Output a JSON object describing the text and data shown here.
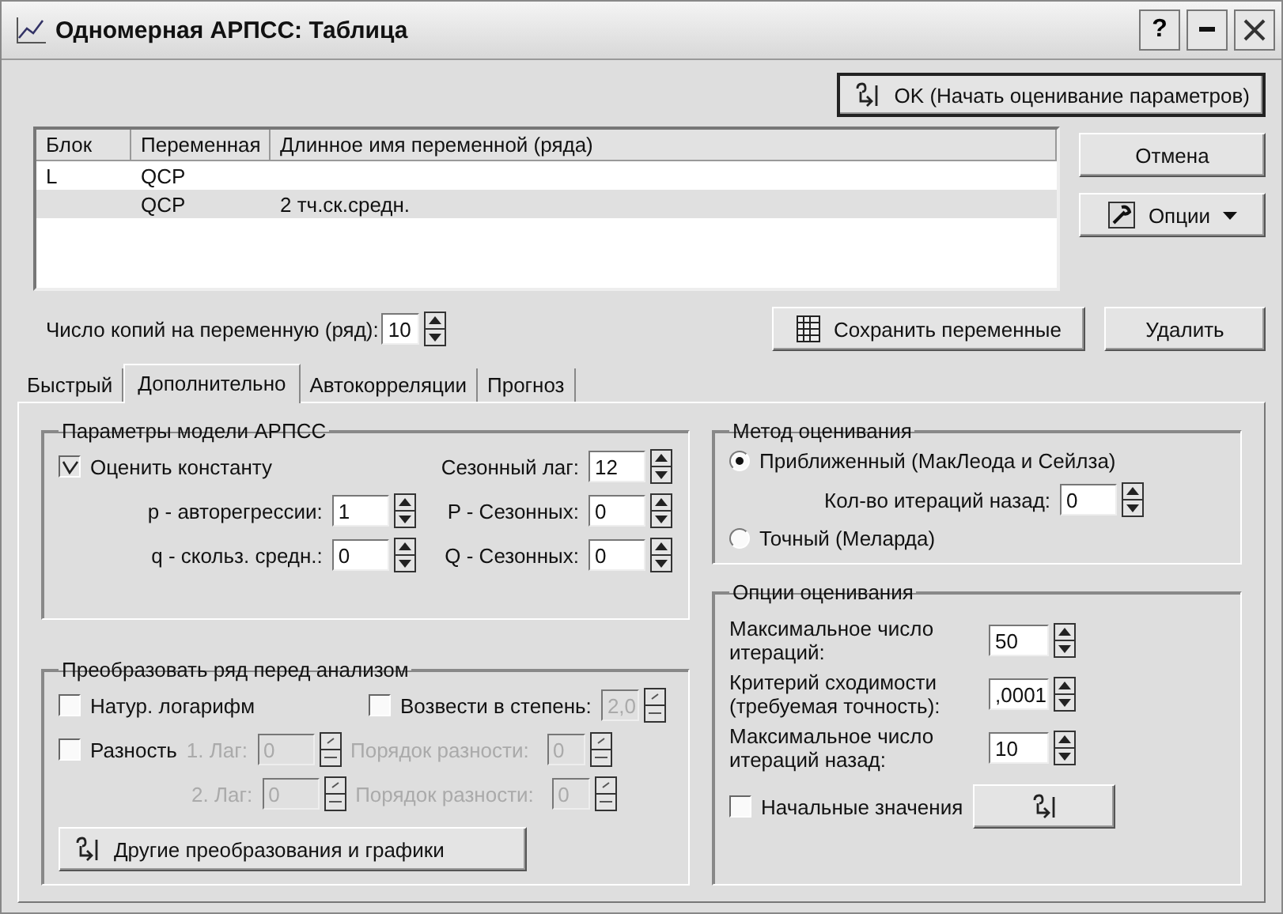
{
  "window": {
    "title": "Одномерная АРПСС: Таблица",
    "help": "?"
  },
  "ok_button": "OK (Начать оценивание параметров)",
  "table": {
    "columns": [
      "Блок",
      "Переменная",
      "Длинное имя переменной (ряда)"
    ],
    "rows": [
      {
        "block": "L",
        "variable": "QCP",
        "selected": false
      },
      {
        "variable": "QCP",
        "long_name": "2 тч.ск.средн.",
        "selected": true
      }
    ]
  },
  "cancel_button": "Отмена",
  "options_button": "Опции",
  "copies": {
    "label": "Число копий на переменную (ряд):",
    "value": "10"
  },
  "save_button": "Сохранить переменные",
  "delete_button": "Удалить",
  "tabs": [
    {
      "label": "Быстрый",
      "selected": false
    },
    {
      "label": "Дополнительно",
      "selected": true
    },
    {
      "label": "Автокорреляции",
      "selected": false
    },
    {
      "label": "Прогноз",
      "selected": false
    }
  ],
  "arima_group": {
    "title": "Параметры модели АРПСС",
    "items": [
      {
        "kind": "checkbox",
        "label": "Оценить константу",
        "checked": true
      },
      {
        "kind": "spin",
        "label": "Сезонный лаг:",
        "value": "12"
      },
      {
        "kind": "spin",
        "label": "p - авторегрессии:",
        "value": "1"
      },
      {
        "kind": "spin",
        "label": "P - Сезонных:",
        "value": "0"
      },
      {
        "kind": "spin",
        "label": "q - скольз. средн.:",
        "value": "0"
      },
      {
        "kind": "spin",
        "label": "Q - Сезонных:",
        "value": "0"
      }
    ]
  },
  "method_group": {
    "title": "Метод оценивания",
    "options": [
      {
        "label": "Приближенный (МакЛеода и Сейлза)",
        "selected": true
      },
      {
        "label": "Точный (Меларда)",
        "selected": false
      }
    ],
    "back_iterations": {
      "label": "Кол-во итераций назад:",
      "value": "0"
    }
  },
  "transform_group": {
    "title": "Преобразовать ряд перед анализом",
    "natural_log": {
      "label": "Натур. логарифм",
      "checked": false
    },
    "power": {
      "label": "Возвести в степень:",
      "checked": false,
      "value": "2,0",
      "disabled": true
    },
    "difference": {
      "label": "Разность",
      "checked": false
    },
    "lags": [
      {
        "lag_label": "1. Лаг:",
        "lag_value": "0",
        "order_label": "Порядок разности:",
        "order_value": "0",
        "disabled": true
      },
      {
        "lag_label": "2. Лаг:",
        "lag_value": "0",
        "order_label": "Порядок разности:",
        "order_value": "0",
        "disabled": true
      }
    ],
    "button": "Другие преобразования и графики"
  },
  "options_group": {
    "title": "Опции оценивания",
    "fields": [
      {
        "lines": [
          "Максимальное число",
          "итераций:"
        ],
        "value": "50"
      },
      {
        "lines": [
          "Критерий сходимости",
          "(требуемая точность):"
        ],
        "value": ",0001"
      },
      {
        "lines": [
          "Максимальное число",
          "итераций назад:"
        ],
        "value": "10"
      }
    ],
    "initial_values": {
      "label": "Начальные значения",
      "checked": false
    }
  }
}
